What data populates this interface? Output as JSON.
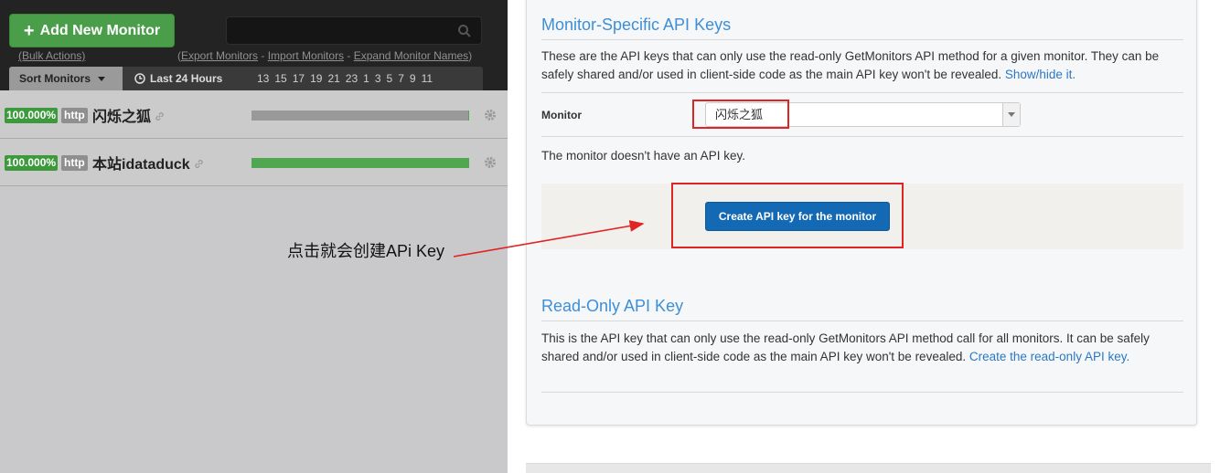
{
  "left": {
    "add_button_label": "Add New Monitor",
    "search_placeholder": "",
    "bulk_actions": "(Bulk Actions)",
    "export_monitors": "Export Monitors",
    "import_monitors": "Import Monitors",
    "expand_names": "Expand Monitor Names",
    "sort_label": "Sort Monitors",
    "range_label": "Last 24 Hours",
    "hours": [
      "13",
      "15",
      "17",
      "19",
      "21",
      "23",
      "1",
      "3",
      "5",
      "7",
      "9",
      "11"
    ],
    "monitors": [
      {
        "uptime": "100.000%",
        "protocol": "http",
        "name": "闪烁之狐",
        "bar_fill": 0.005
      },
      {
        "uptime": "100.000%",
        "protocol": "http",
        "name": "本站idataduck",
        "bar_fill": 1.0
      }
    ]
  },
  "annotation": {
    "text": "点击就会创建APi Key"
  },
  "right": {
    "monitor_section": {
      "title": "Monitor-Specific API Keys",
      "description": "These are the API keys that can only use the read-only GetMonitors API method for a given monitor. They can be safely shared and/or used in client-side code as the main API key won't be revealed.",
      "toggle_link": "Show/hide it.",
      "monitor_label": "Monitor",
      "selected_monitor": "闪烁之狐",
      "no_key_text": "The monitor doesn't have an API key.",
      "create_button": "Create API key for the monitor"
    },
    "readonly_section": {
      "title": "Read-Only API Key",
      "description": "This is the API key that can only use the read-only GetMonitors API method call for all monitors. It can be safely shared and/or used in client-side code as the main API key won't be revealed.",
      "create_link": "Create the read-only API key."
    }
  },
  "colors": {
    "accent_blue": "#3d8fd6",
    "button_blue": "#1469b4",
    "up_green": "#3c9a3c",
    "highlight_red": "#e02424"
  }
}
